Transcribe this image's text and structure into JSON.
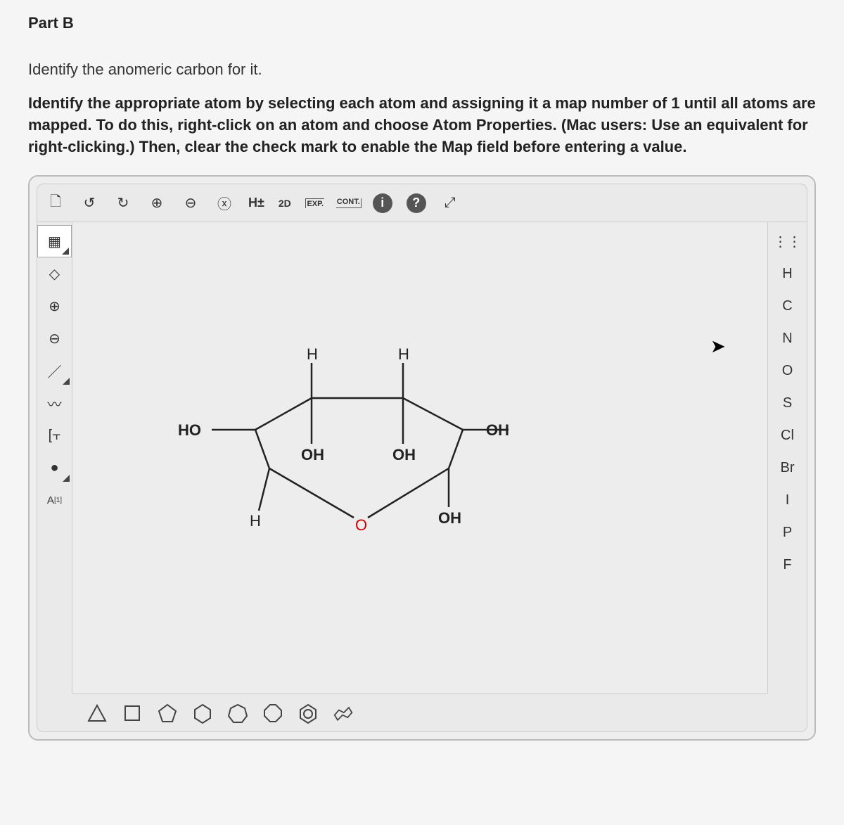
{
  "part_label": "Part B",
  "prompt1": "Identify the anomeric carbon for it.",
  "prompt2": "Identify the appropriate atom by selecting each atom and assigning it a map number of 1 until all atoms are mapped. To do this, right-click on an atom and choose Atom Properties. (Mac users: Use an equivalent for right-clicking.) Then, clear the check mark to enable the Map field before entering a value.",
  "top_toolbar": {
    "new": "🗋",
    "undo": "↺",
    "redo": "↻",
    "zoom_in": "⊕",
    "zoom_out": "⊖",
    "delete": "ⓧ",
    "hydrogens": "H±",
    "to2d": "2D",
    "exp": "EXP.",
    "cont": "CONT.",
    "info": "i",
    "help": "?",
    "fullscreen": "⤢"
  },
  "left_toolbar": {
    "marquee": "▦",
    "eraser": "◇",
    "plus": "⊕",
    "minus": "⊖",
    "bond": "／",
    "chain": "〰",
    "group": "[⫟",
    "stereo": "●",
    "map": "A[1]"
  },
  "right_toolbar": {
    "periodic": "⋮⋮",
    "H": "H",
    "C": "C",
    "N": "N",
    "O": "O",
    "S": "S",
    "Cl": "Cl",
    "Br": "Br",
    "I": "I",
    "P": "P",
    "F": "F"
  },
  "molecule": {
    "labels": {
      "HO": "HO",
      "OH1": "OH",
      "OH2": "OH",
      "OH3": "OH",
      "OH4": "OH",
      "H1": "H",
      "H2": "H",
      "H3": "H",
      "O": "O"
    }
  }
}
